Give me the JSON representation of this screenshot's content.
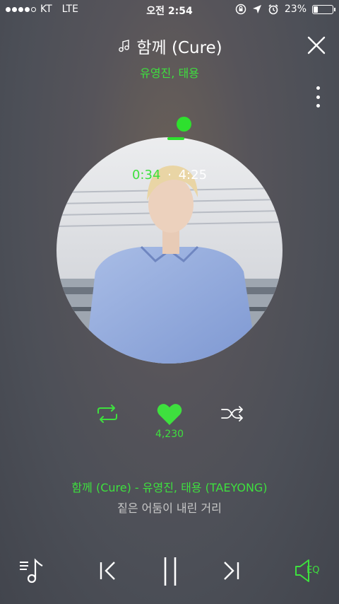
{
  "status": {
    "carrier": "KT",
    "network": "LTE",
    "time": "오전 2:54",
    "battery": "23%",
    "battery_level": 0.23
  },
  "header": {
    "title": "함께 (Cure)",
    "artist": "유영진, 태용"
  },
  "player": {
    "current_time": "0:34",
    "total_time": "4:25",
    "progress": 0.128,
    "like_count": "4,230"
  },
  "lyrics": {
    "track_line": "함께 (Cure) - 유영진, 태용 (TAEYONG)",
    "current_line": "짙은 어둠이 내린 거리"
  },
  "controls": {
    "eq_label": "EQ"
  },
  "colors": {
    "accent": "#3ee03e",
    "text": "#ffffff",
    "muted": "#c9c9c9"
  }
}
